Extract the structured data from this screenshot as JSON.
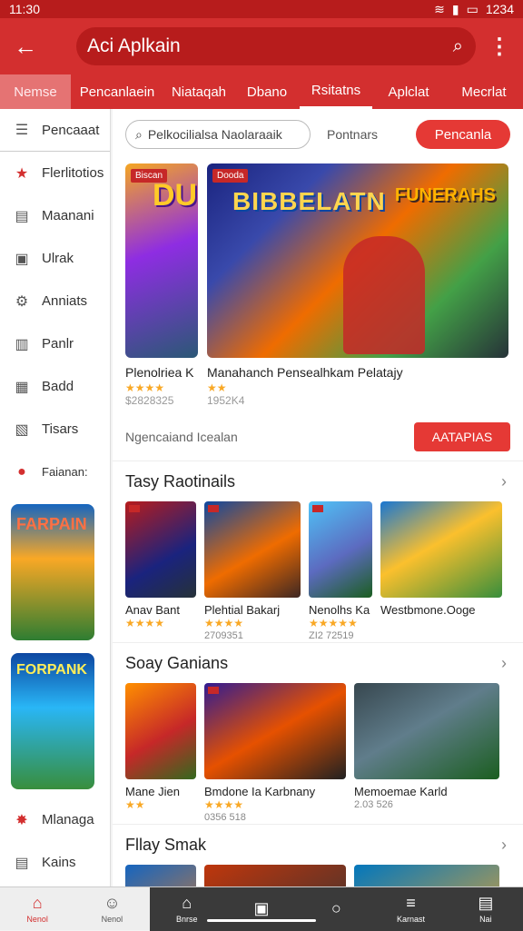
{
  "status": {
    "time": "11:30",
    "right_text": "1234"
  },
  "app_bar": {
    "title": "Aci Aplkain"
  },
  "tabs": [
    "Nemse",
    "Pencanlaein",
    "Niataqah",
    "Dbano",
    "Rsitatns",
    "Aplclat",
    "Mecrlat"
  ],
  "sidebar": {
    "items": [
      {
        "label": "Pencaaat",
        "icon": "layout-icon"
      },
      {
        "label": "Flerlitotios",
        "icon": "star-icon"
      },
      {
        "label": "Maanani",
        "icon": "gamepad-icon"
      },
      {
        "label": "Ulrak",
        "icon": "bag-icon"
      },
      {
        "label": "Anniats",
        "icon": "gear-icon"
      },
      {
        "label": "Panlr",
        "icon": "document-icon"
      },
      {
        "label": "Badd",
        "icon": "image-icon"
      },
      {
        "label": "Tisars",
        "icon": "chart-icon"
      },
      {
        "label": "Faianan:",
        "icon": "red-circle-icon"
      }
    ],
    "bottom_items": [
      {
        "label": "Mlanaga",
        "icon": "star-icon"
      },
      {
        "label": "Kains",
        "icon": "gamepad-icon"
      }
    ],
    "art1_title": "FARPAIN",
    "art2_title": "FORPANK"
  },
  "main": {
    "search_placeholder": "Pelkocilialsa Naolaraaik",
    "search_link": "Pontnars",
    "search_button": "Pencanla",
    "hero": {
      "small_badge": "Biscan",
      "big_badge": "Dooda",
      "big_art_title": "BIBBELATN",
      "big_art_subtitle": "FUNERAHS",
      "caption1": "Plenolriea K",
      "caption2": "Manahanch Pensealhkam Pelatajy",
      "meta1": "$2828325",
      "meta2": "1952K4"
    },
    "promo_text": "Ngencaiand Icealan",
    "promo_button": "AATAPIAS",
    "sections": [
      {
        "title": "Tasy Raotinails",
        "cards": [
          {
            "name": "Anav Bant",
            "stars": "★★★★",
            "meta": ""
          },
          {
            "name": "Plehtial Bakarj",
            "stars": "★★★★",
            "meta": "2709351"
          },
          {
            "name": "Nenolhs Ka",
            "stars": "★★★★★",
            "meta": "ZI2 72519"
          },
          {
            "name": "Westbmone.Ooge",
            "stars": "",
            "meta": ""
          }
        ]
      },
      {
        "title": "Soay Ganians",
        "cards": [
          {
            "name": "Mane Jien",
            "stars": "★★",
            "meta": ""
          },
          {
            "name": "Bmdone Ia Karbnany",
            "stars": "★★★★",
            "meta": "0356 518"
          },
          {
            "name": "Memoemae Karld",
            "stars": "",
            "meta": "2.03 526"
          }
        ]
      },
      {
        "title": "Fllay Smak",
        "cards": []
      }
    ]
  },
  "bottom_nav": [
    {
      "label": "Nenol",
      "icon": "home-icon"
    },
    {
      "label": "Nenol",
      "icon": "person-icon"
    },
    {
      "label": "Bnrse",
      "icon": "store-icon"
    },
    {
      "label": "",
      "icon": "square-icon"
    },
    {
      "label": "",
      "icon": "chat-icon"
    },
    {
      "label": "Karnast",
      "icon": "stack-icon"
    },
    {
      "label": "Nai",
      "icon": "box-icon"
    }
  ]
}
